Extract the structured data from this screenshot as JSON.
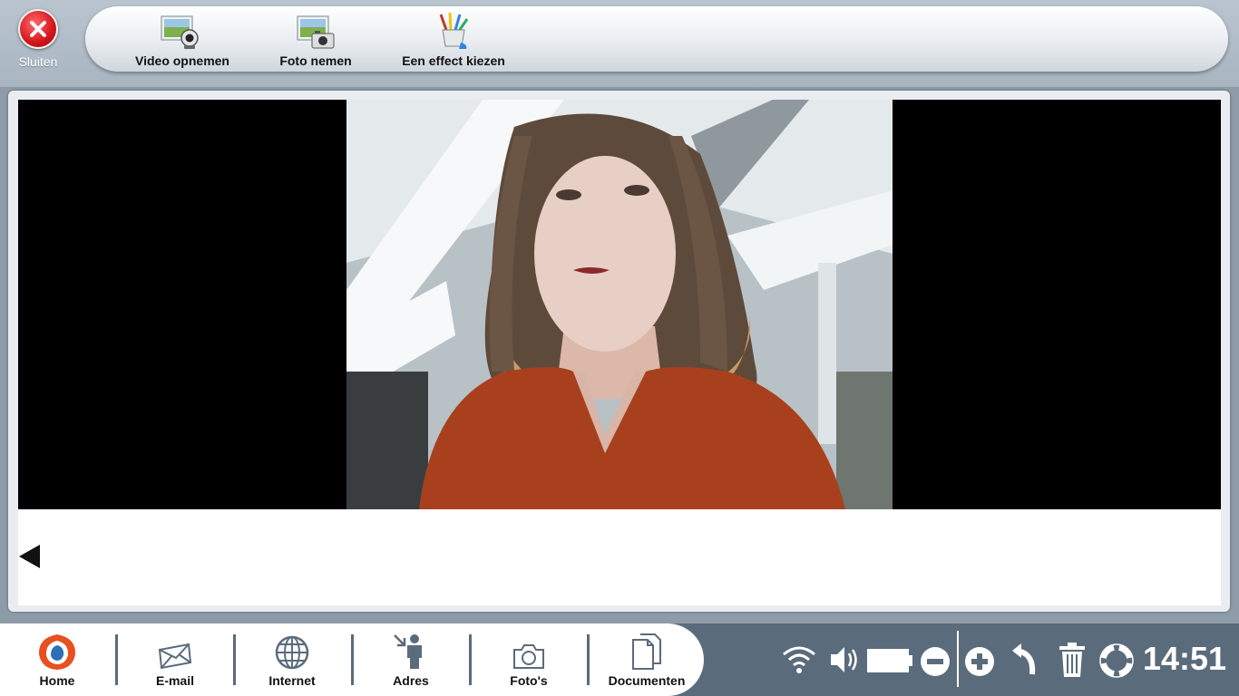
{
  "window": {
    "close_label": "Sluiten"
  },
  "toolbar": {
    "items": [
      {
        "label": "Video opnemen",
        "icon": "webcam-icon"
      },
      {
        "label": "Foto nemen",
        "icon": "camera-icon"
      },
      {
        "label": "Een effect kiezen",
        "icon": "brushes-icon"
      }
    ]
  },
  "taskbar": {
    "apps": [
      {
        "label": "Home",
        "icon": "home-logo-icon"
      },
      {
        "label": "E-mail",
        "icon": "envelope-icon"
      },
      {
        "label": "Internet",
        "icon": "globe-icon"
      },
      {
        "label": "Adres",
        "icon": "person-icon"
      },
      {
        "label": "Foto's",
        "icon": "camera-icon"
      },
      {
        "label": "Documenten",
        "icon": "documents-icon"
      }
    ],
    "tray": [
      "wifi-icon",
      "volume-icon",
      "battery-icon",
      "zoom-out-icon",
      "zoom-in-icon",
      "undo-icon",
      "trash-icon",
      "help-icon"
    ],
    "clock": "14:51"
  },
  "colors": {
    "taskbar": "#5a6b7c",
    "close_red": "#d4141b",
    "accent_orange": "#e8501f"
  }
}
